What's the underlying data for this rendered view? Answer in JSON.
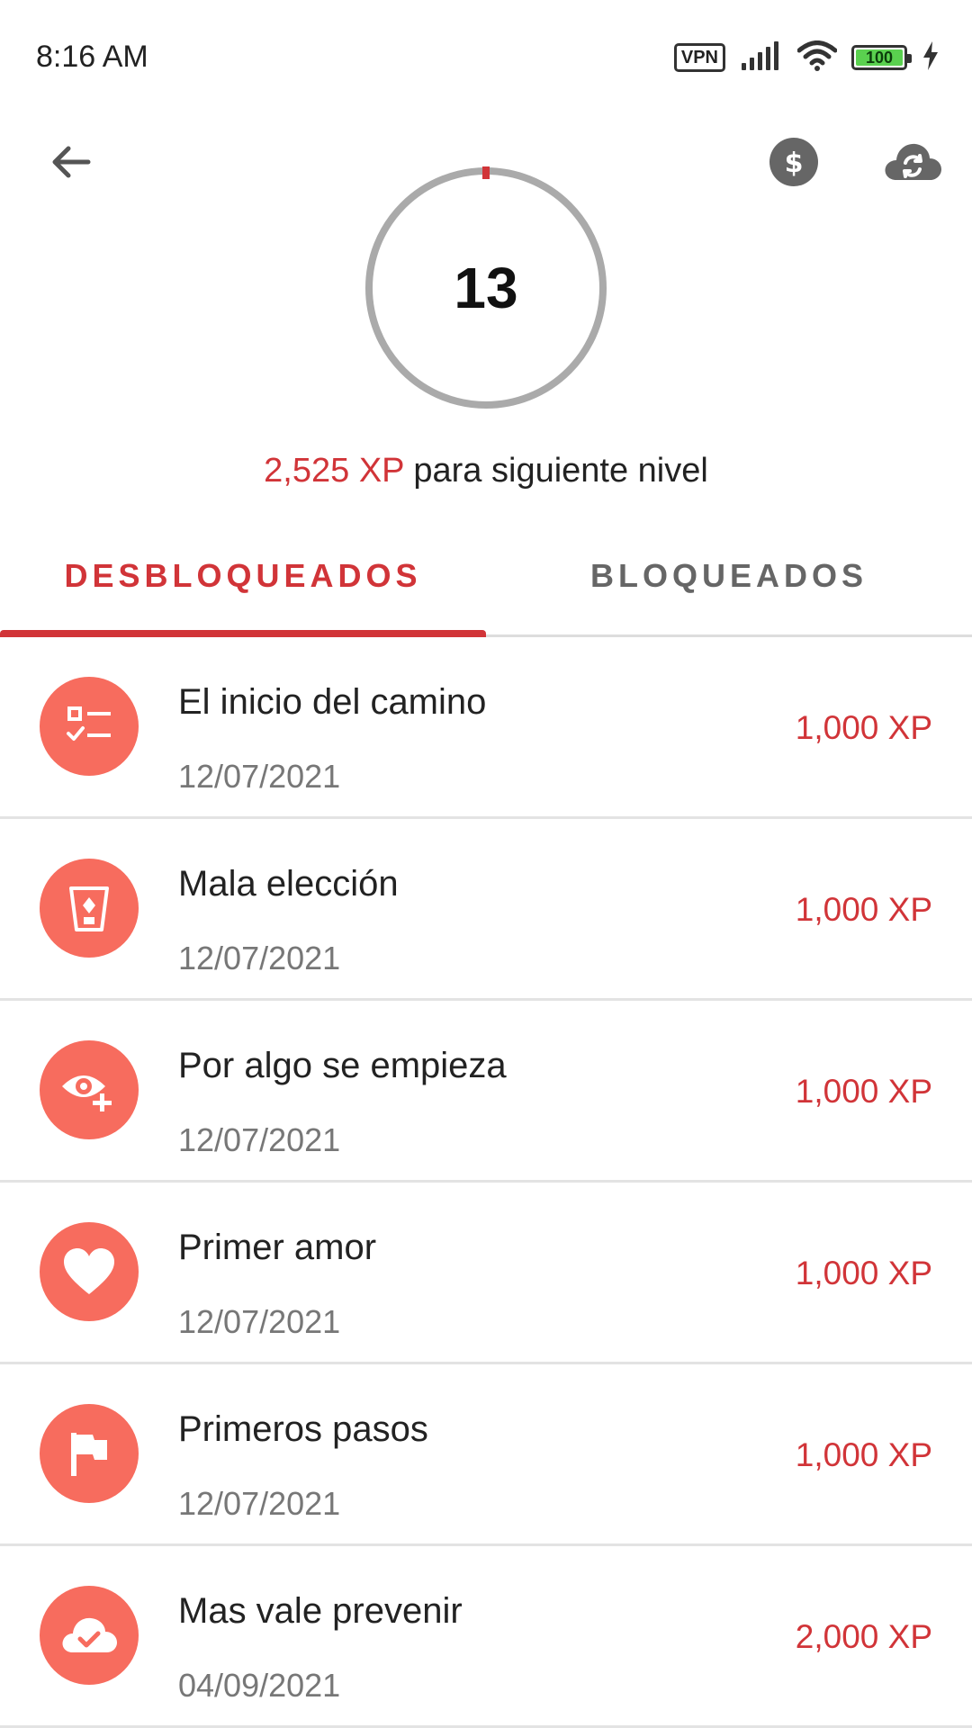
{
  "status_bar": {
    "time": "8:16 AM",
    "vpn_label": "VPN",
    "battery": "100",
    "icons": [
      "signal-icon",
      "wifi-icon",
      "battery-icon",
      "charging-icon"
    ]
  },
  "header": {
    "back_icon": "arrow-back-icon",
    "coin_icon": "dollar-coin-icon",
    "sync_icon": "cloud-sync-icon"
  },
  "level": {
    "number": "13",
    "xp_amount": "2,525 XP",
    "xp_suffix": " para siguiente nivel"
  },
  "tabs": [
    {
      "label": "DESBLOQUEADOS",
      "active": true
    },
    {
      "label": "BLOQUEADOS",
      "active": false
    }
  ],
  "achievements": [
    {
      "title": "El inicio del camino",
      "date": "12/07/2021",
      "xp": "1,000 XP",
      "icon": "checklist-icon"
    },
    {
      "title": "Mala elección",
      "date": "12/07/2021",
      "xp": "1,000 XP",
      "icon": "trash-cup-icon"
    },
    {
      "title": "Por algo se empieza",
      "date": "12/07/2021",
      "xp": "1,000 XP",
      "icon": "eye-plus-icon"
    },
    {
      "title": "Primer amor",
      "date": "12/07/2021",
      "xp": "1,000 XP",
      "icon": "heart-icon"
    },
    {
      "title": "Primeros pasos",
      "date": "12/07/2021",
      "xp": "1,000 XP",
      "icon": "flag-icon"
    },
    {
      "title": "Mas vale prevenir",
      "date": "04/09/2021",
      "xp": "2,000 XP",
      "icon": "cloud-check-icon"
    }
  ],
  "colors": {
    "accent": "#d13438",
    "icon_bg": "#f76c5e",
    "ring": "#aaaaaa"
  }
}
